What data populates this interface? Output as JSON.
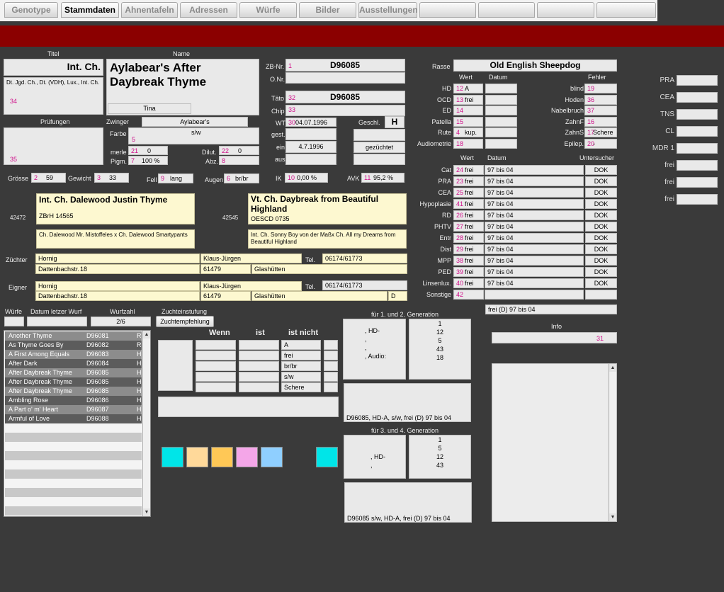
{
  "tabs": [
    "Genotype",
    "Stammdaten",
    "Ahnentafeln",
    "Adressen",
    "Würfe",
    "Bilder",
    "Ausstellungen"
  ],
  "labels": {
    "titel": "Titel",
    "name": "Name",
    "pruefungen": "Prüfungen",
    "zwinger": "Zwinger",
    "farbe": "Farbe",
    "merle": "merle",
    "pigm": "Pigm.",
    "dilut": "Dilut.",
    "abz": "Abz.",
    "zbnr": "ZB-Nr.",
    "onr": "O.Nr.",
    "taeto": "Täto",
    "chip": "Chip",
    "wt": "WT",
    "gest": "gest.",
    "ein": "ein",
    "aus": "aus",
    "geschl": "Geschl.",
    "groesse": "Grösse",
    "gewicht": "Gewicht",
    "fell": "Fell",
    "augen": "Augen",
    "ik": "IK",
    "avk": "AVK",
    "zuechter": "Züchter",
    "eigner": "Eigner",
    "tel": "Tel.",
    "wuerfe": "Würfe",
    "datum_letzter_wurf": "Datum letzer Wurf",
    "wurfzahl": "Wurfzahl",
    "zuchteinstufung": "Zuchteinstufung",
    "wenn": "Wenn",
    "ist": "ist",
    "ist_nicht": "ist nicht",
    "gen12": "für 1. und 2. Generation",
    "gen34": "für 3. und 4. Generation",
    "rasse": "Rasse",
    "wert": "Wert",
    "datum": "Datum",
    "fehler": "Fehler",
    "untersucher": "Untersucher",
    "info": "Info"
  },
  "dog": {
    "titel": "Int. Ch.",
    "titles_long": "Dt. Jgd. Ch., Dt. (VDH), Lux., Int. Ch.",
    "titel_nr": "34",
    "name": "Aylabear's After Daybreak Thyme",
    "rufname": "Tina",
    "pruef_nr": "35",
    "zwinger": "Aylabear's",
    "farbe_nr": "5",
    "farbe": "s/w",
    "merle_nr": "21",
    "merle": "0",
    "pigm_nr": "7",
    "pigm": "100 %",
    "dilut_nr": "22",
    "dilut": "0",
    "abz_nr": "8",
    "zbnr_nr": "1",
    "zbnr": "D96085",
    "taeto_nr": "32",
    "taeto": "D96085",
    "chip_nr": "33",
    "wt_nr": "30",
    "wt": "04.07.1996",
    "ein": "4.7.1996",
    "gezuechtet": "gezüchtet",
    "geschl": "H",
    "groesse_nr": "2",
    "groesse": "59",
    "gewicht_nr": "3",
    "gewicht": "33",
    "fell_nr": "9",
    "fell": "lang",
    "augen_nr": "6",
    "augen": "br/br",
    "ik_nr": "10",
    "ik": "0,00 %",
    "avk_nr": "11",
    "avk": "95,2 %"
  },
  "parents": {
    "father_id": "42472",
    "father": "Int. Ch. Dalewood Justin Thyme",
    "father_zb": "ZBrH 14565",
    "father_parents": "Ch. Dalewood Mr. Mistoffeles x Ch. Dalewood Smartypants",
    "mother_id": "42545",
    "mother": "Vt. Ch. Daybreak from Beautiful Highland",
    "mother_zb": "OESCD 0735",
    "mother_parents": "Int. Ch. Sonny Boy von der Maßx Ch. All my Dreams from  Beautiful  Highland"
  },
  "zuechter": {
    "name": "Hornig",
    "vorname": "Klaus-Jürgen",
    "strasse": "Dattenbachstr.",
    "nr": "18",
    "plz": "61479",
    "ort": "Glashütten",
    "tel": "06174/61773"
  },
  "eigner": {
    "name": "Hornig",
    "vorname": "Klaus-Jürgen",
    "strasse": "Dattenbachstr.",
    "nr": "18",
    "plz": "61479",
    "ort": "Glashütten",
    "land": "D",
    "tel": "06174/61773"
  },
  "wurf": {
    "wurfzahl": "2/6",
    "zuchtempfehlung": "Zuchtempfehlung"
  },
  "litter": [
    {
      "name": "Another  Thyme",
      "zb": "D96081",
      "sex": "R"
    },
    {
      "name": "As Thyme Goes By",
      "zb": "D96082",
      "sex": "R"
    },
    {
      "name": "A First Among Equals",
      "zb": "D96083",
      "sex": "H"
    },
    {
      "name": "After Dark",
      "zb": "D96084",
      "sex": "H"
    },
    {
      "name": "After  Daybreak  Thyme",
      "zb": "D96085",
      "sex": "H"
    },
    {
      "name": "After  Daybreak  Thyme",
      "zb": "D96085",
      "sex": "H"
    },
    {
      "name": "After  Daybreak  Thyme",
      "zb": "D96085",
      "sex": "H"
    },
    {
      "name": "Ambling  Rose",
      "zb": "D96086",
      "sex": "H"
    },
    {
      "name": "A Part o' m' Heart",
      "zb": "D96087",
      "sex": "H"
    },
    {
      "name": "Armful  of  Love",
      "zb": "D96088",
      "sex": "H"
    }
  ],
  "filter_ist": [
    "A",
    "frei",
    "br/br",
    "s/w",
    "Schere"
  ],
  "gen12": {
    "left": ", HD-\n,\n,\n, Audio:",
    "right": "1\n12\n5\n43\n18",
    "summary": "D96085, HD-A, s/w, frei (D) 97 bis 04"
  },
  "gen34": {
    "left": ", HD-\n,",
    "right": "1\n5\n12\n43",
    "summary": "D96085 s/w, HD-A, frei (D) 97 bis 04"
  },
  "rasse": "Old English Sheepdog",
  "health1": [
    {
      "label": "HD",
      "nr": "12",
      "wert": "A"
    },
    {
      "label": "OCD",
      "nr": "13",
      "wert": "frei"
    },
    {
      "label": "ED",
      "nr": "14",
      "wert": ""
    },
    {
      "label": "Patella",
      "nr": "15",
      "wert": ""
    },
    {
      "label": "Rute",
      "nr": "4",
      "wert": "kup."
    },
    {
      "label": "Audiometrie",
      "nr": "18",
      "wert": ""
    }
  ],
  "fehler": [
    {
      "label": "blind",
      "nr": "19",
      "wert": ""
    },
    {
      "label": "Hoden",
      "nr": "36",
      "wert": ""
    },
    {
      "label": "Nabelbruch",
      "nr": "37",
      "wert": ""
    },
    {
      "label": "ZahnF",
      "nr": "16",
      "wert": ""
    },
    {
      "label": "ZahnS",
      "nr": "17",
      "wert": "Schere"
    },
    {
      "label": "Epilep.",
      "nr": "20",
      "wert": "-"
    }
  ],
  "eyes": [
    {
      "label": "Cat",
      "nr": "24",
      "wert": "frei",
      "datum": "97 bis 04",
      "unt": "DOK"
    },
    {
      "label": "PRA",
      "nr": "23",
      "wert": "frei",
      "datum": "97 bis 04",
      "unt": "DOK"
    },
    {
      "label": "CEA",
      "nr": "25",
      "wert": "frei",
      "datum": "97 bis 04",
      "unt": "DOK"
    },
    {
      "label": "Hypoplasie",
      "nr": "41",
      "wert": "frei",
      "datum": "97 bis 04",
      "unt": "DOK"
    },
    {
      "label": "RD",
      "nr": "26",
      "wert": "frei",
      "datum": "97 bis 04",
      "unt": "DOK"
    },
    {
      "label": "PHTV",
      "nr": "27",
      "wert": "frei",
      "datum": "97 bis 04",
      "unt": "DOK"
    },
    {
      "label": "Entr",
      "nr": "28",
      "wert": "frei",
      "datum": "97 bis 04",
      "unt": "DOK"
    },
    {
      "label": "Dist",
      "nr": "29",
      "wert": "frei",
      "datum": "97 bis 04",
      "unt": "DOK"
    },
    {
      "label": "MPP",
      "nr": "38",
      "wert": "frei",
      "datum": "97 bis 04",
      "unt": "DOK"
    },
    {
      "label": "PED",
      "nr": "39",
      "wert": "frei",
      "datum": "97 bis 04",
      "unt": "DOK"
    },
    {
      "label": "Linsenlux.",
      "nr": "40",
      "wert": "frei",
      "datum": "97 bis 04",
      "unt": "DOK"
    },
    {
      "label": "Sonstige",
      "nr": "42",
      "wert": "",
      "datum": "",
      "unt": ""
    }
  ],
  "eyes_summary": "frei (D) 97 bis 04",
  "info_nr": "31",
  "right_tests": [
    {
      "label": "PRA",
      "wert": ""
    },
    {
      "label": "CEA",
      "wert": ""
    },
    {
      "label": "TNS",
      "wert": ""
    },
    {
      "label": "CL",
      "wert": ""
    },
    {
      "label": "MDR 1",
      "wert": ""
    },
    {
      "label": "frei",
      "wert": ""
    },
    {
      "label": "frei",
      "wert": ""
    },
    {
      "label": "frei",
      "wert": ""
    }
  ],
  "colors": {
    "red_bar": "#8b0000",
    "swatches": [
      "#00e5e8",
      "#ffd99a",
      "#ffc856",
      "#f4a6e8",
      "#8fcfff",
      "#00e5e8"
    ]
  }
}
